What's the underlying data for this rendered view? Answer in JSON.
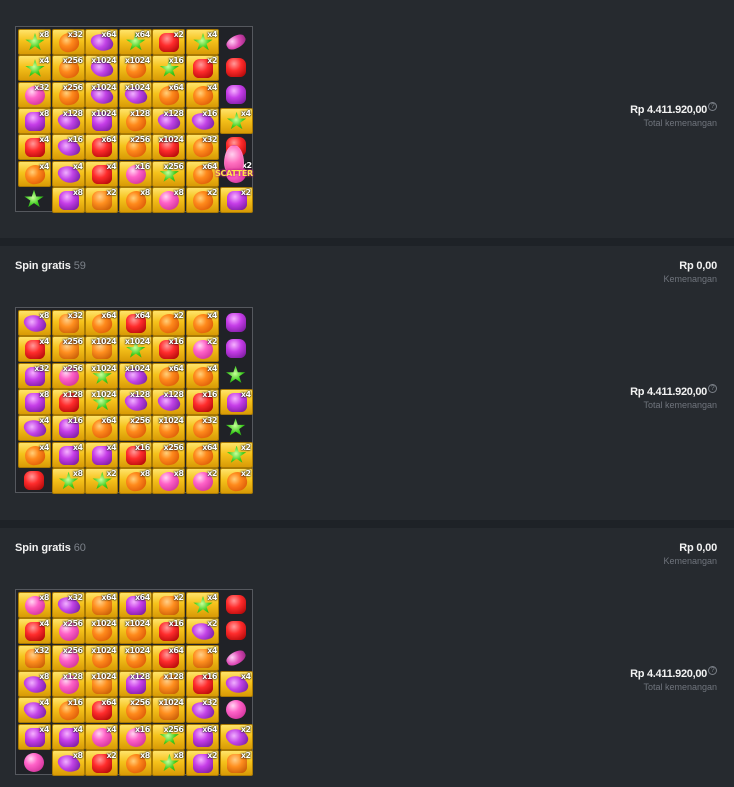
{
  "colors": {
    "background": "#1e2227",
    "panel": "#262a2f",
    "text_primary": "#f2f2f2",
    "text_muted": "#6f747c",
    "gold_tile": "#f5c21b"
  },
  "rounds": [
    {
      "title": "",
      "number": "",
      "win_amount": "",
      "win_label": "",
      "total_amount": "Rp 4.411.920,00",
      "total_label": "Total kemenangan",
      "help_icon": "question-circle-icon",
      "grid": [
        [
          "star|g|x8",
          "candy-orange|g|x32",
          "candy-purple|g|x64",
          "star|g|x64",
          "bear-red|g|x2",
          "star|g|x4",
          "candy-bean||"
        ],
        [
          "star|g|x4",
          "candy-orange|g|x256",
          "candy-purple|g|x1024",
          "candy-orange|g|x1024",
          "star|g|x16",
          "bear-red|g|x2",
          "bear-red||"
        ],
        [
          "candy-pink|g|x32",
          "candy-orange|g|x256",
          "candy-purple|g|x1024",
          "candy-purple|g|x1024",
          "candy-orange|g|x64",
          "candy-orange|g|x4",
          "bear-purple||"
        ],
        [
          "bear-purple|g|x8",
          "candy-purple|g|x128",
          "bear-purple|g|x1024",
          "candy-orange|g|x128",
          "candy-purple|g|x128",
          "candy-purple|g|x16",
          "star|g|x4"
        ],
        [
          "bear-red|g|x4",
          "candy-purple|g|x16",
          "bear-red|g|x64",
          "candy-orange|g|x256",
          "bear-red|g|x1024",
          "candy-orange|g|x32",
          "bear-red||"
        ],
        [
          "candy-orange|g|x4",
          "candy-purple|g|x4",
          "bear-red|g|x4",
          "candy-pink|g|x16",
          "star|g|x256",
          "candy-orange|g|x64",
          "candy-pink||x2"
        ],
        [
          "star||",
          "bear-purple|g|x8",
          "bear-orange|g|x2",
          "candy-orange|g|x8",
          "candy-pink|g|x8",
          "candy-orange|g|x2",
          "bear-purple|g|x2"
        ]
      ],
      "scatter_label": "SCATTER"
    },
    {
      "title": "Spin gratis",
      "number": "59",
      "win_amount": "Rp 0,00",
      "win_label": "Kemenangan",
      "total_amount": "Rp 4.411.920,00",
      "total_label": "Total kemenangan",
      "help_icon": "question-circle-icon",
      "grid": [
        [
          "candy-purple|g|x8",
          "bear-orange|g|x32",
          "candy-orange|g|x64",
          "bear-red|g|x64",
          "candy-orange|g|x2",
          "candy-orange|g|x4",
          "bear-purple||"
        ],
        [
          "bear-red|g|x4",
          "bear-orange|g|x256",
          "bear-orange|g|x1024",
          "star|g|x1024",
          "bear-red|g|x16",
          "candy-pink|g|x2",
          "bear-purple||"
        ],
        [
          "bear-purple|g|x32",
          "candy-pink|g|x256",
          "star|g|x1024",
          "candy-purple|g|x1024",
          "candy-orange|g|x64",
          "candy-orange|g|x4",
          "star||"
        ],
        [
          "bear-purple|g|x8",
          "bear-red|g|x128",
          "star|g|x1024",
          "candy-purple|g|x128",
          "candy-purple|g|x128",
          "bear-red|g|x16",
          "bear-purple|g|x4"
        ],
        [
          "candy-purple|g|x4",
          "bear-purple|g|x16",
          "candy-orange|g|x64",
          "candy-orange|g|x256",
          "candy-orange|g|x1024",
          "candy-orange|g|x32",
          "star||"
        ],
        [
          "candy-orange|g|x4",
          "bear-purple|g|x4",
          "bear-purple|g|x4",
          "bear-red|g|x16",
          "candy-orange|g|x256",
          "candy-orange|g|x64",
          "star|g|x2"
        ],
        [
          "bear-red||",
          "star|g|x8",
          "star|g|x2",
          "candy-orange|g|x8",
          "candy-pink|g|x8",
          "candy-pink|g|x2",
          "candy-orange|g|x2"
        ]
      ],
      "scatter_label": ""
    },
    {
      "title": "Spin gratis",
      "number": "60",
      "win_amount": "Rp 0,00",
      "win_label": "Kemenangan",
      "total_amount": "Rp 4.411.920,00",
      "total_label": "Total kemenangan",
      "help_icon": "question-circle-icon",
      "grid": [
        [
          "candy-pink|g|x8",
          "candy-purple|g|x32",
          "bear-orange|g|x64",
          "bear-purple|g|x64",
          "bear-orange|g|x2",
          "star|g|x4",
          "bear-red||"
        ],
        [
          "bear-red|g|x4",
          "candy-pink|g|x256",
          "candy-orange|g|x1024",
          "candy-orange|g|x1024",
          "bear-red|g|x16",
          "candy-purple|g|x2",
          "bear-red||"
        ],
        [
          "bear-orange|g|x32",
          "candy-pink|g|x256",
          "candy-orange|g|x1024",
          "candy-orange|g|x1024",
          "bear-red|g|x64",
          "bear-orange|g|x4",
          "candy-bean||"
        ],
        [
          "candy-purple|g|x8",
          "candy-pink|g|x128",
          "bear-orange|g|x1024",
          "bear-purple|g|x128",
          "bear-orange|g|x128",
          "bear-red|g|x16",
          "candy-purple|g|x4"
        ],
        [
          "candy-purple|g|x4",
          "candy-orange|g|x16",
          "bear-red|g|x64",
          "candy-orange|g|x256",
          "bear-orange|g|x1024",
          "candy-purple|g|x32",
          "candy-pink||"
        ],
        [
          "bear-purple|g|x4",
          "bear-purple|g|x4",
          "candy-pink|g|x4",
          "candy-pink|g|x16",
          "star|g|x256",
          "bear-purple|g|x64",
          "candy-purple|g|x2"
        ],
        [
          "candy-pink||",
          "candy-purple|g|x8",
          "bear-red|g|x2",
          "candy-orange|g|x8",
          "star|g|x8",
          "bear-purple|g|x2",
          "bear-orange|g|x2"
        ]
      ],
      "scatter_label": ""
    }
  ]
}
